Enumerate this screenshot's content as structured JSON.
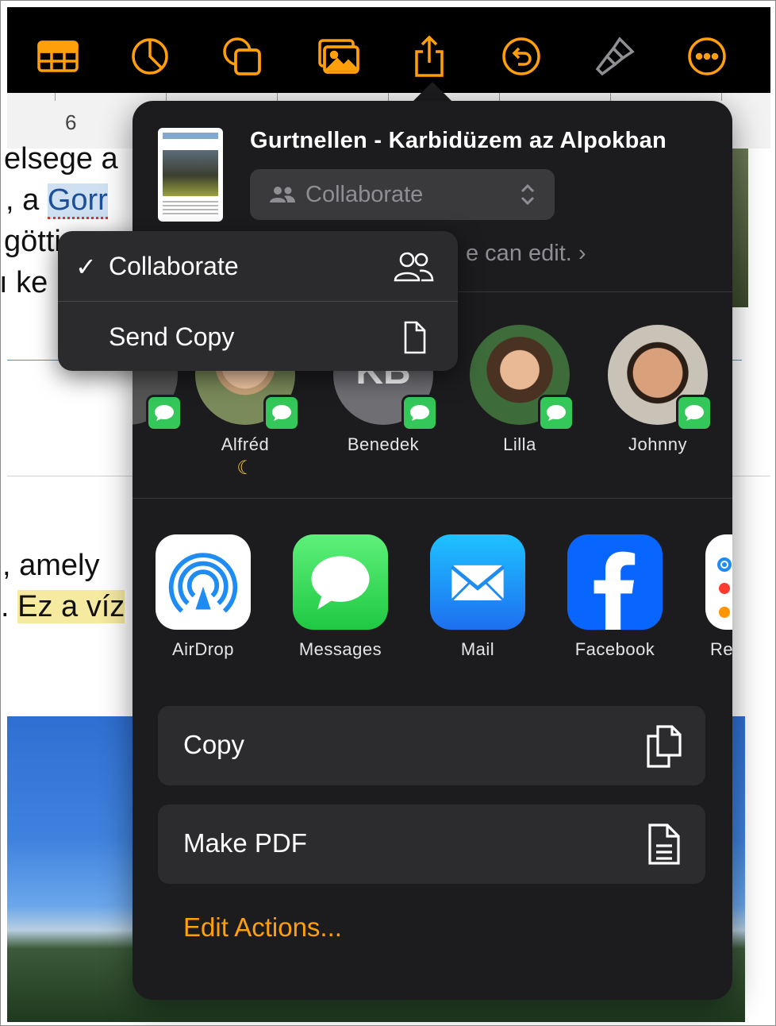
{
  "colors": {
    "accent": "#ff9f0a",
    "sheet_bg": "#1c1c1e",
    "messages_green": "#34c759",
    "mail_blue": "#1e8cf2",
    "facebook_blue": "#0866ff"
  },
  "toolbar": {
    "icons": [
      "table-icon",
      "chart-icon",
      "shapes-icon",
      "media-icon",
      "share-icon",
      "undo-icon",
      "format-brush-icon",
      "more-icon"
    ]
  },
  "ruler": {
    "marker": "6"
  },
  "document": {
    "line1": "elsege  a",
    "line2_prefix": ",  a ",
    "line2_highlight": "Gorr",
    "line3": "götti",
    "line4": "ı  ke",
    "line5": ",   amely",
    "line6_prefix": ". ",
    "line6_highlight": "Ez a víz"
  },
  "share_sheet": {
    "title": "Gurtnellen - Karbidüzem az Alpokban",
    "mode_selected": "Collaborate",
    "permission_text": "e can edit. ›",
    "people": [
      {
        "name": "Alfréd",
        "status": "☾"
      },
      {
        "name": "Benedek",
        "initials": "KB"
      },
      {
        "name": "Lilla"
      },
      {
        "name": "Johnny"
      }
    ],
    "apps": [
      {
        "label": "AirDrop"
      },
      {
        "label": "Messages"
      },
      {
        "label": "Mail"
      },
      {
        "label": "Facebook"
      },
      {
        "label": "Rer"
      }
    ],
    "actions": [
      {
        "label": "Copy"
      },
      {
        "label": "Make PDF"
      }
    ],
    "edit_actions": "Edit Actions..."
  },
  "mode_menu": {
    "items": [
      {
        "check": "✓",
        "label": "Collaborate"
      },
      {
        "label": "Send Copy"
      }
    ]
  }
}
